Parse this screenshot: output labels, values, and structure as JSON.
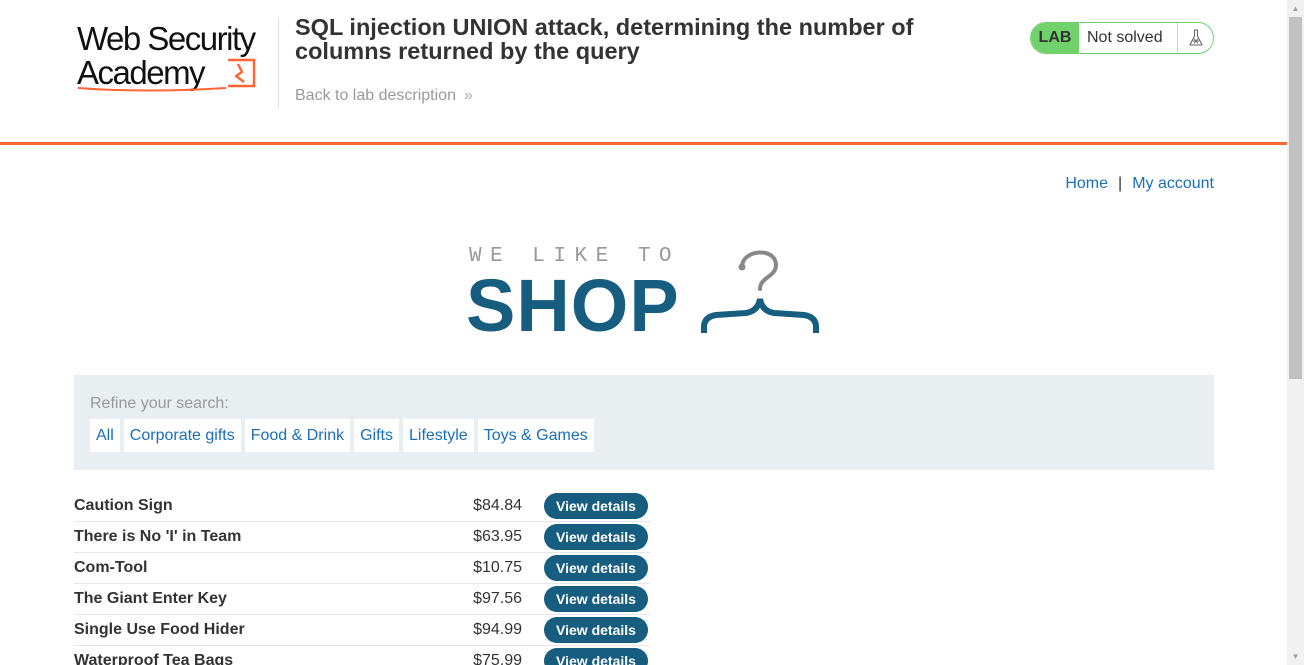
{
  "header": {
    "logo_line1": "Web Security",
    "logo_line2": "Academy",
    "lab_title": "SQL injection UNION attack, determining the number of columns returned by the query",
    "back_link": "Back to lab description",
    "back_chevron": "»",
    "status": {
      "badge": "LAB",
      "text": "Not solved",
      "icon": "flask-icon"
    }
  },
  "nav": {
    "home": "Home",
    "separator": "|",
    "my_account": "My account"
  },
  "banner": {
    "tagline": "WE LIKE TO",
    "word": "SHOP",
    "icon": "hanger-icon"
  },
  "filters": {
    "label": "Refine your search:",
    "items": [
      "All",
      "Corporate gifts",
      "Food & Drink",
      "Gifts",
      "Lifestyle",
      "Toys & Games"
    ]
  },
  "products": [
    {
      "name": "Caution Sign",
      "price": "$84.84",
      "button": "View details"
    },
    {
      "name": "There is No 'I' in Team",
      "price": "$63.95",
      "button": "View details"
    },
    {
      "name": "Com-Tool",
      "price": "$10.75",
      "button": "View details"
    },
    {
      "name": "The Giant Enter Key",
      "price": "$97.56",
      "button": "View details"
    },
    {
      "name": "Single Use Food Hider",
      "price": "$94.99",
      "button": "View details"
    },
    {
      "name": "Waterproof Tea Bags",
      "price": "$75.99",
      "button": "View details"
    }
  ],
  "colors": {
    "accent_orange": "#ff6633",
    "brand_blue": "#165d80",
    "link_blue": "#1a6fb8",
    "status_green": "#70d16d",
    "filter_bg": "#e9eef1"
  }
}
